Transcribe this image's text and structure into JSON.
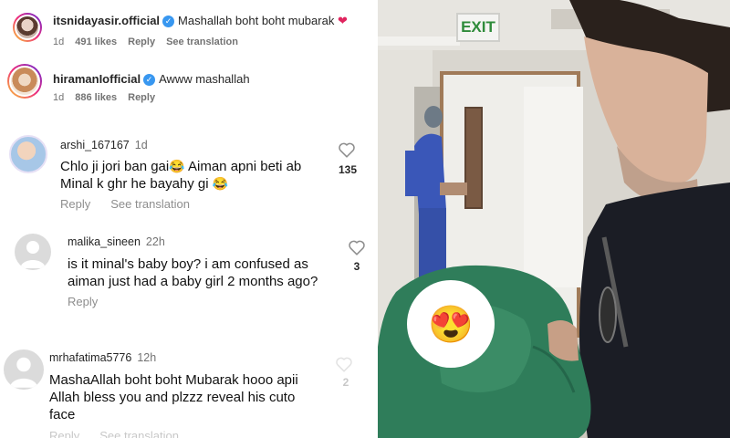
{
  "comments": [
    {
      "username": "itsnidayasir.official",
      "verified": true,
      "text": "Mashallah boht boht mubarak",
      "time": "1d",
      "likes": "491 likes",
      "reply": "Reply",
      "see_translation": "See translation"
    },
    {
      "username": "hiramanIofficial",
      "verified": true,
      "text": "Awww mashallah",
      "time": "1d",
      "likes": "886 likes",
      "reply": "Reply"
    },
    {
      "username": "arshi_167167",
      "time": "1d",
      "text_line1": "Chlo ji jori ban gai",
      "text_line1b": " Aiman apni beti ab",
      "text_line2": "Minal k ghr he bayahy gi",
      "reply": "Reply",
      "see_translation": "See translation",
      "like_count": "135"
    },
    {
      "username": "malika_sineen",
      "time": "22h",
      "text_line1": "is it minal's baby boy? i am confused as",
      "text_line2": "aiman just had a baby girl 2 months ago?",
      "reply": "Reply",
      "like_count": "3"
    },
    {
      "username": "mrhafatima5776",
      "time": "12h",
      "text_line1": "MashaAllah boht boht Mubarak hooo apii",
      "text_line2": "Allah bless you and plzzz reveal his cuto",
      "text_line3": "face",
      "reply": "Reply",
      "see_translation": "See translation",
      "like_count": "2"
    }
  ],
  "photo": {
    "exit_sign": "EXIT",
    "face_cover_emoji": "😍"
  },
  "colors": {
    "verified_blue": "#3897f0",
    "exit_green": "#2e8b3a",
    "scrubs_blue": "#3a57b8",
    "swaddle_green": "#2f7d5a"
  }
}
